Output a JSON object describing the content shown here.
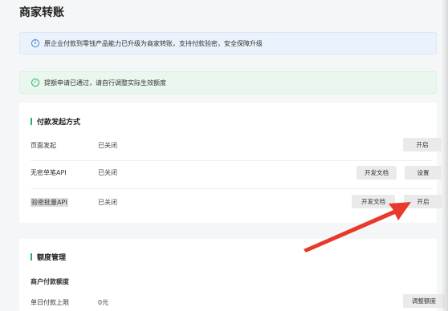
{
  "header": {
    "title": "商家转账"
  },
  "notices": {
    "info": {
      "text": "原企业付款到零钱产品能力已升级为商家转账，支持付款验密，安全保障升级",
      "icon": "info-circle-icon",
      "color": "#3f7fd6"
    },
    "success": {
      "text": "提额申请已通过，请自行调整实际生效额度",
      "icon": "check-circle-icon",
      "color": "#2aae67"
    }
  },
  "payment_methods": {
    "title": "付款发起方式",
    "rows": [
      {
        "name": "页面发起",
        "status": "已关闭",
        "action": "开启"
      },
      {
        "name": "无密单笔API",
        "status": "已关闭",
        "doc": "开发文档",
        "action": "设置"
      },
      {
        "name": "验密批量API",
        "status": "已关闭",
        "doc": "开发文档",
        "action": "开启"
      }
    ]
  },
  "quota": {
    "title": "额度管理",
    "subtitle": "商户付款额度",
    "row": {
      "name": "单日付款上限",
      "value": "0元",
      "action": "调整额度"
    }
  },
  "annotation": {
    "arrow_color": "#e8392b"
  },
  "accent": "#2aae67"
}
